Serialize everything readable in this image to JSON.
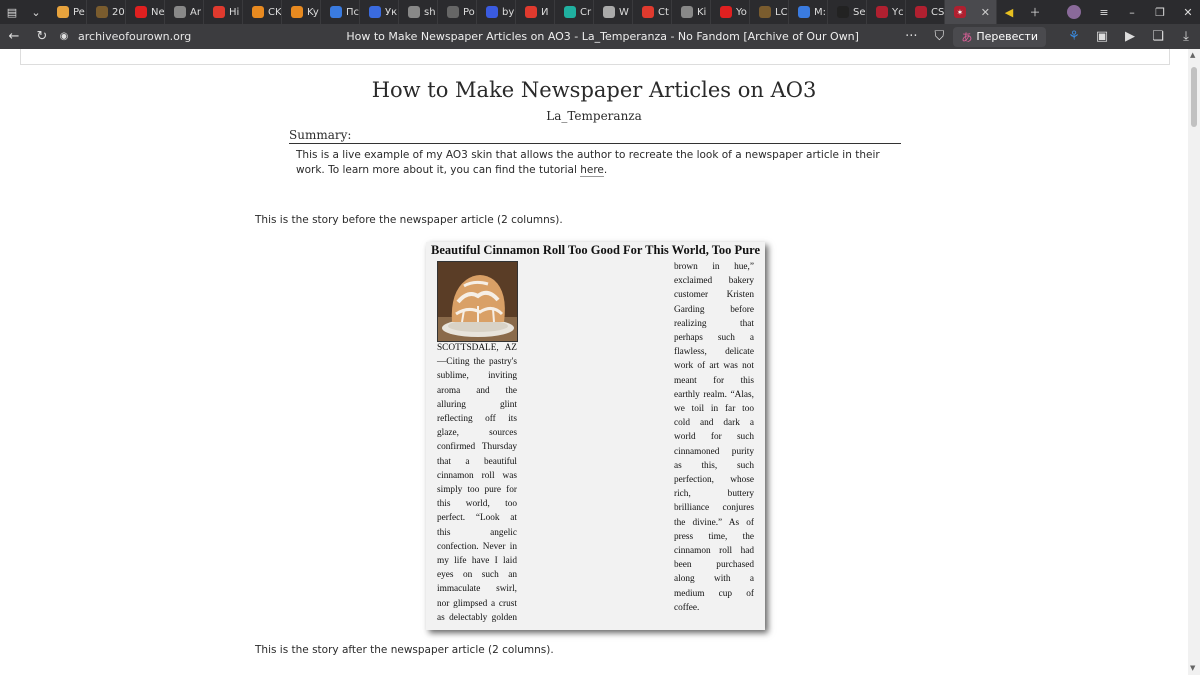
{
  "browser": {
    "tabs": [
      {
        "label": "Pe",
        "icon": "pencil-icon",
        "color": "#e8a33d"
      },
      {
        "label": "20",
        "icon": "y-icon",
        "color": "#7a5c2e"
      },
      {
        "label": "Ne",
        "icon": "youtube-icon",
        "color": "#e02020"
      },
      {
        "label": "Ar",
        "icon": "document-icon",
        "color": "#888888"
      },
      {
        "label": "Hi",
        "icon": "yandex-icon",
        "color": "#e03a2e"
      },
      {
        "label": "CK",
        "icon": "dns-icon",
        "color": "#e88a20"
      },
      {
        "label": "Ky",
        "icon": "dns-icon",
        "color": "#e88a20"
      },
      {
        "label": "Пс",
        "icon": "search-icon",
        "color": "#3a7be0"
      },
      {
        "label": "Ук",
        "icon": "doc-icon",
        "color": "#3a6be0"
      },
      {
        "label": "sh",
        "icon": "globe-icon",
        "color": "#888888"
      },
      {
        "label": "Po",
        "icon": "square-icon",
        "color": "#666666"
      },
      {
        "label": "by",
        "icon": "grid-icon",
        "color": "#3a5be0"
      },
      {
        "label": "И",
        "icon": "yandex-icon",
        "color": "#e03a2e"
      },
      {
        "label": "Cr",
        "icon": "chat-icon",
        "color": "#20b0a0"
      },
      {
        "label": "W",
        "icon": "compass-icon",
        "color": "#aaaaaa"
      },
      {
        "label": "Ct",
        "icon": "yandex-icon",
        "color": "#e03a2e"
      },
      {
        "label": "Ki",
        "icon": "pen-icon",
        "color": "#888888"
      },
      {
        "label": "Yo",
        "icon": "youtube-icon",
        "color": "#e02020"
      },
      {
        "label": "LC",
        "icon": "y-icon",
        "color": "#7a5c2e"
      },
      {
        "label": "M:",
        "icon": "message-icon",
        "color": "#3a7be0"
      },
      {
        "label": "Se",
        "icon": "x-icon",
        "color": "#222222"
      },
      {
        "label": "Yc",
        "icon": "ao3-icon",
        "color": "#b02030"
      },
      {
        "label": "CS",
        "icon": "ao3-icon",
        "color": "#b02030"
      }
    ],
    "active_tab_icon": "ao3-icon",
    "url": "archiveofourown.org",
    "page_title": "How to Make Newspaper Articles on AO3 - La_Temperanza - No Fandom [Archive of Our Own]",
    "translate_label": "Перевести"
  },
  "work": {
    "title": "How to Make Newspaper Articles on AO3",
    "author": "La_Temperanza",
    "summary_heading": "Summary:",
    "summary_text": "This is a live example of my AO3 skin that allows the author to recreate the look of a newspaper article in their work. To learn more about it, you can find the tutorial ",
    "summary_link": "here",
    "summary_end": ".",
    "story_before": "This is the story before the newspaper article (2 columns).",
    "story_after": "This is the story after the newspaper article (2 columns).",
    "article": {
      "headline": "Beautiful Cinnamon Roll Too Good For This World, Too Pure",
      "col1": [
        "SCOTTSDALE, AZ",
        "—Citing the pastry's",
        "sublime, inviting",
        "aroma and the",
        "alluring glint",
        "reflecting off its",
        "glaze, sources",
        "confirmed Thursday",
        "that a beautiful",
        "cinnamon roll was",
        "simply too pure for",
        "this world, too",
        "perfect. “Look at",
        "this angelic",
        "confection. Never in",
        "my life have I laid",
        "eyes on such an",
        "immaculate swirl,",
        "nor glimpsed a crust",
        "as delectably golden"
      ],
      "col2": [
        "brown in hue,”",
        "exclaimed bakery",
        "customer Kristen",
        "Garding before",
        "realizing that",
        "perhaps such a",
        "flawless, delicate",
        "work of art was not",
        "meant for this",
        "earthly realm. “Alas,",
        "we toil in far too",
        "cold and dark a",
        "world for such",
        "cinnamoned purity",
        "as this, such",
        "perfection, whose",
        "rich, buttery",
        "brilliance conjures",
        "the divine.” As of",
        "press time, the",
        "cinnamon roll had",
        "been purchased",
        "along with a",
        "medium cup of",
        "coffee."
      ]
    }
  }
}
